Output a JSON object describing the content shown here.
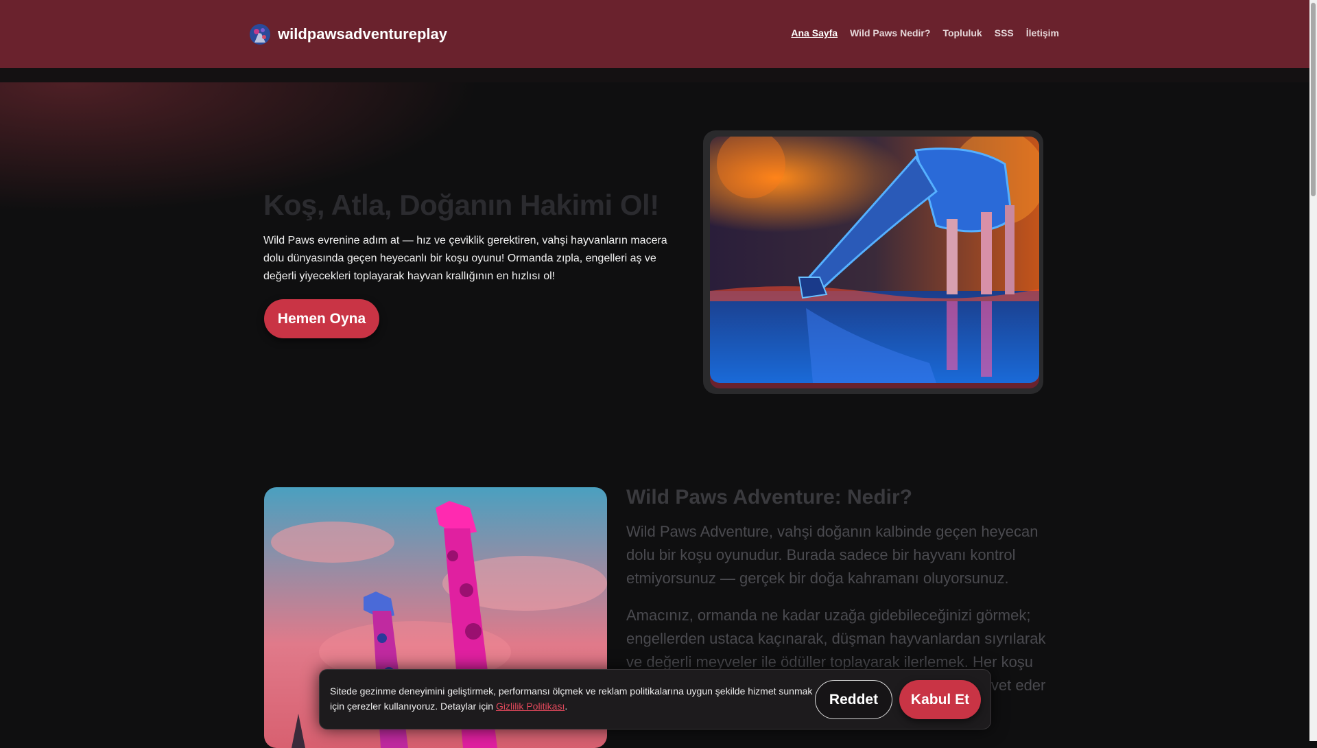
{
  "header": {
    "brand_name": "wildpawsadventureplay",
    "logo_icon": "giraffe-logo-icon",
    "nav": [
      {
        "label": "Ana Sayfa",
        "active": true
      },
      {
        "label": "Wild Paws Nedir?"
      },
      {
        "label": "Topluluk"
      },
      {
        "label": "SSS"
      },
      {
        "label": "İletişim"
      }
    ]
  },
  "hero": {
    "title": "Koş, Atla, Doğanın Hakimi Ol!",
    "text": "Wild Paws evrenine adım at — hız ve çeviklik gerektiren, vahşi hayvanların macera dolu dünyasında geçen heyecanlı bir koşu oyunu! Ormanda zıpla, engelleri aş ve değerli yiyecekleri toplayarak hayvan krallığının en hızlısı ol!",
    "cta_label": "Hemen Oyna",
    "image_icon": "neon-giraffe-drinking-image"
  },
  "about": {
    "title": "Wild Paws Adventure: Nedir?",
    "p1": "Wild Paws Adventure, vahşi doğanın kalbinde geçen heyecan dolu bir koşu oyunudur. Burada sadece bir hayvanı kontrol etmiyorsunuz — gerçek bir doğa kahramanı oluyorsunuz.",
    "p2": "Amacınız, ormanda ne kadar uzağa gidebileceğinizi görmek; engellerden ustaca kaçınarak, düşman hayvanlardan sıyrılarak ve değerli meyveler ile ödüller toplayarak ilerlemek. Her koşu yeni bir macera sunar ve sizi sınırlarınızı zorlamaya davet eder — vahşi doğanın zorluklarını aşabilir misiniz?",
    "image_icon": "neon-giraffes-sky-image"
  },
  "cookie": {
    "text": "Sitede gezinme deneyimini geliştirmek, performansı ölçmek ve reklam politikalarına uygun şekilde hizmet sunmak için çerezler kullanıyoruz. Detaylar için",
    "link_label": "Gizlilik Politikası",
    "after_link": ".",
    "reject_label": "Reddet",
    "accept_label": "Kabul Et"
  },
  "colors": {
    "header_bg": "#6a222d",
    "accent": "#c93445",
    "page_bg": "#0f0f10"
  }
}
